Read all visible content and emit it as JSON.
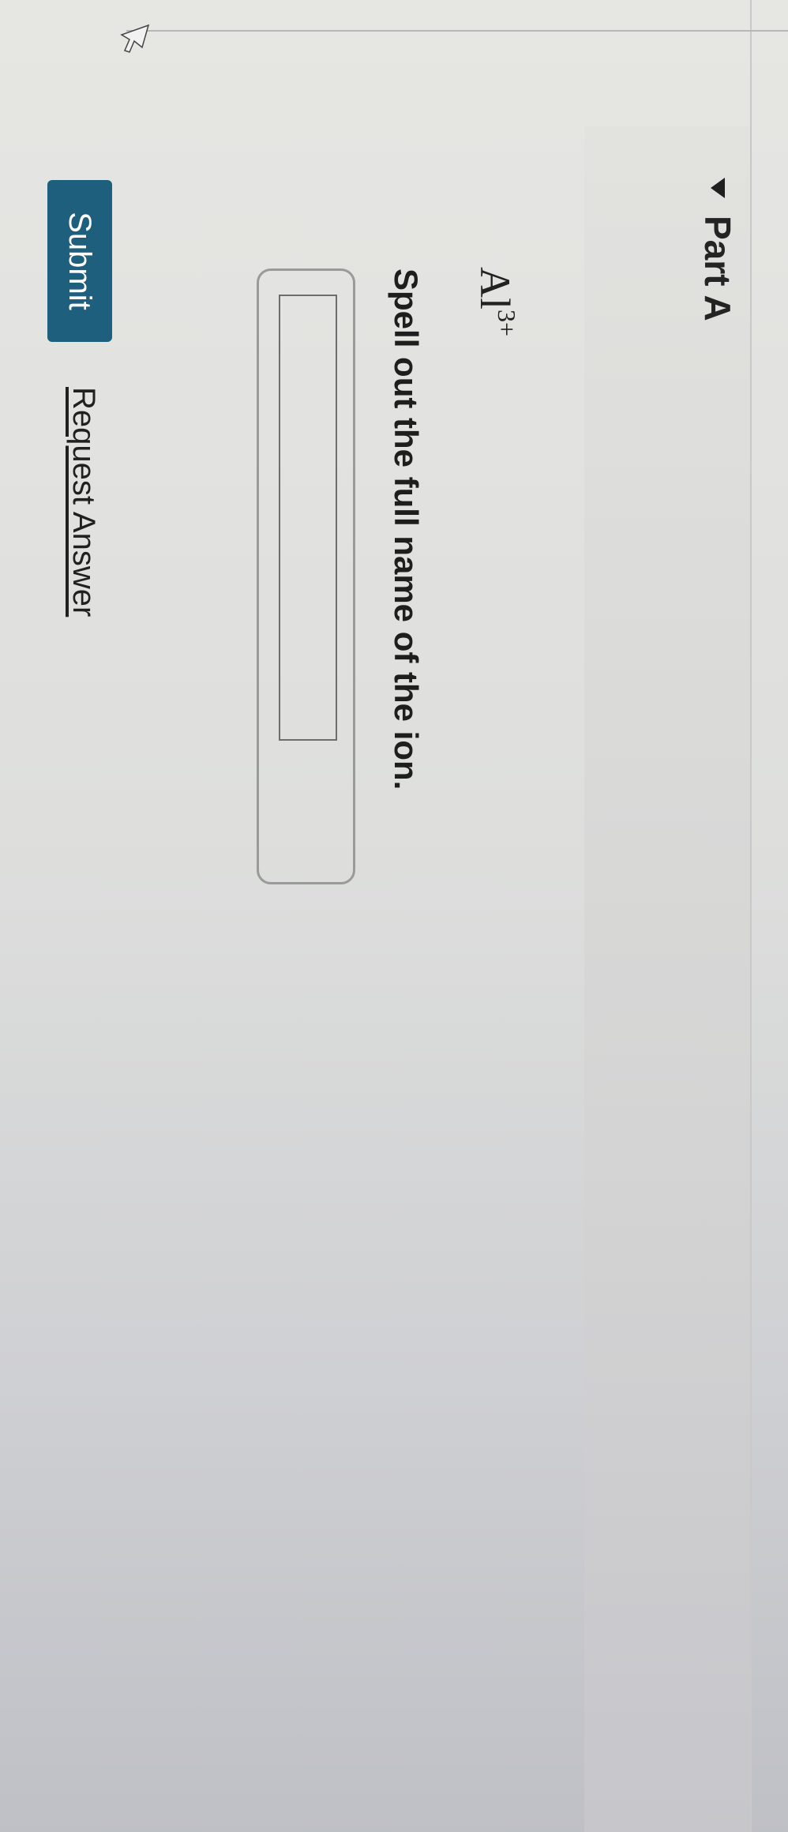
{
  "part": {
    "title": "Part A"
  },
  "question": {
    "ion_symbol": "Al",
    "ion_charge": "3+",
    "prompt": "Spell out the full name of the ion."
  },
  "answer": {
    "value": ""
  },
  "actions": {
    "submit_label": "Submit",
    "request_answer_label": "Request Answer"
  },
  "colors": {
    "submit_bg": "#1e5f7d",
    "text": "#222222"
  },
  "icons": {
    "collapse": "triangle-down-icon",
    "pointer": "mouse-cursor-icon"
  }
}
